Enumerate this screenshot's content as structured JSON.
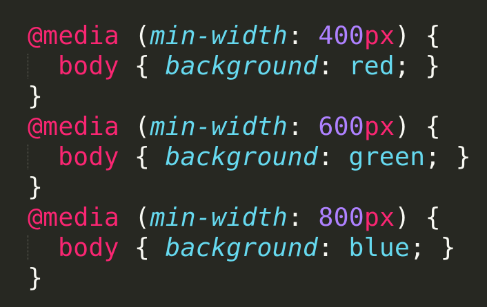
{
  "editor": {
    "theme_colors": {
      "background": "#272822",
      "punctuation": "#f8f8f2",
      "keyword": "#f92672",
      "property": "#66d9ef",
      "number": "#ae81ff"
    },
    "blocks": [
      {
        "at_rule": "@media",
        "open_paren": "(",
        "feature": "min-width",
        "colon": ":",
        "number": "400",
        "unit": "px",
        "close_paren": ")",
        "open_brace": "{",
        "selector": "body",
        "inner_open": "{",
        "property": "background",
        "prop_colon": ":",
        "value": "red",
        "semicolon": ";",
        "inner_close": "}",
        "close_brace": "}"
      },
      {
        "at_rule": "@media",
        "open_paren": "(",
        "feature": "min-width",
        "colon": ":",
        "number": "600",
        "unit": "px",
        "close_paren": ")",
        "open_brace": "{",
        "selector": "body",
        "inner_open": "{",
        "property": "background",
        "prop_colon": ":",
        "value": "green",
        "semicolon": ";",
        "inner_close": "}",
        "close_brace": "}"
      },
      {
        "at_rule": "@media",
        "open_paren": "(",
        "feature": "min-width",
        "colon": ":",
        "number": "800",
        "unit": "px",
        "close_paren": ")",
        "open_brace": "{",
        "selector": "body",
        "inner_open": "{",
        "property": "background",
        "prop_colon": ":",
        "value": "blue",
        "semicolon": ";",
        "inner_close": "}",
        "close_brace": "}"
      }
    ]
  }
}
